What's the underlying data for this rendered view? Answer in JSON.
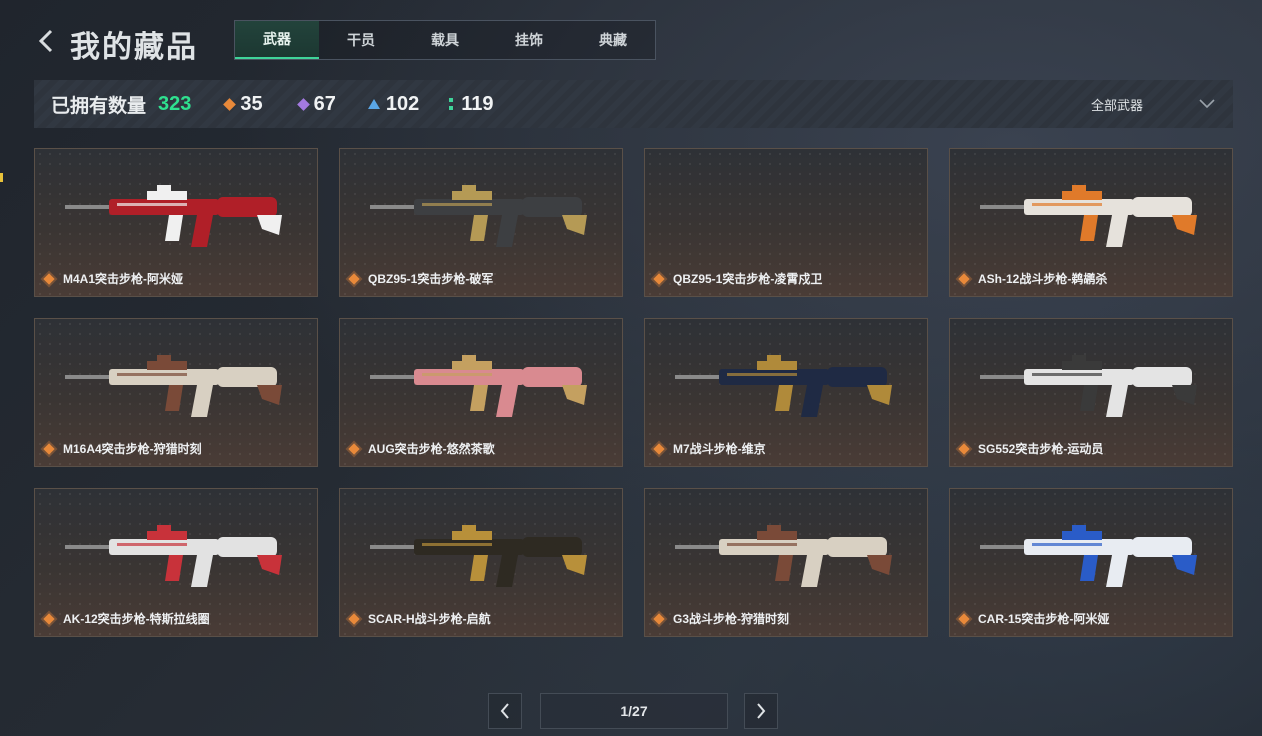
{
  "header": {
    "title": "我的藏品",
    "tabs": [
      {
        "label": "武器",
        "active": true
      },
      {
        "label": "干员",
        "active": false
      },
      {
        "label": "载具",
        "active": false
      },
      {
        "label": "挂饰",
        "active": false
      },
      {
        "label": "典藏",
        "active": false
      }
    ]
  },
  "stats": {
    "owned_label": "已拥有数量",
    "owned_count": "323",
    "rarity_counts": [
      {
        "icon": "orange-diamond-icon",
        "color": "#e8893a",
        "count": "35"
      },
      {
        "icon": "purple-diamond-icon",
        "color": "#a37ae0",
        "count": "67"
      },
      {
        "icon": "blue-triangle-icon",
        "color": "#5aa6e6",
        "count": "102"
      },
      {
        "icon": "green-dots-icon",
        "color": "#3fd49a",
        "count": "119"
      }
    ],
    "filter_label": "全部武器"
  },
  "items": [
    {
      "name": "M4A1突击步枪-阿米娅",
      "color": "#b01f28",
      "accent": "#f0f0f0"
    },
    {
      "name": "QBZ95-1突击步枪-破军",
      "color": "#3d3f42",
      "accent": "#b59a55"
    },
    {
      "name": "QBZ95-1突击步枪-凌霄戍卫",
      "color": "",
      "accent": ""
    },
    {
      "name": "ASh-12战斗步枪-鹈鹕杀",
      "color": "#e6e2dc",
      "accent": "#e07a2a"
    },
    {
      "name": "M16A4突击步枪-狩猎时刻",
      "color": "#d8d0c2",
      "accent": "#7a4a38"
    },
    {
      "name": "AUG突击步枪-悠然茶歌",
      "color": "#d98a90",
      "accent": "#c4a060"
    },
    {
      "name": "M7战斗步枪-维京",
      "color": "#1f2a44",
      "accent": "#b08a3a"
    },
    {
      "name": "SG552突击步枪-运动员",
      "color": "#e4e4e4",
      "accent": "#3a3a3a"
    },
    {
      "name": "AK-12突击步枪-特斯拉线圈",
      "color": "#e2e2e2",
      "accent": "#c8323a"
    },
    {
      "name": "SCAR-H战斗步枪-启航",
      "color": "#2e2a22",
      "accent": "#b8903a"
    },
    {
      "name": "G3战斗步枪-狩猎时刻",
      "color": "#d8d0c2",
      "accent": "#7a4a38"
    },
    {
      "name": "CAR-15突击步枪-阿米娅",
      "color": "#e8ecf2",
      "accent": "#2a5cc8"
    }
  ],
  "pagination": {
    "page_text": "1/27"
  }
}
